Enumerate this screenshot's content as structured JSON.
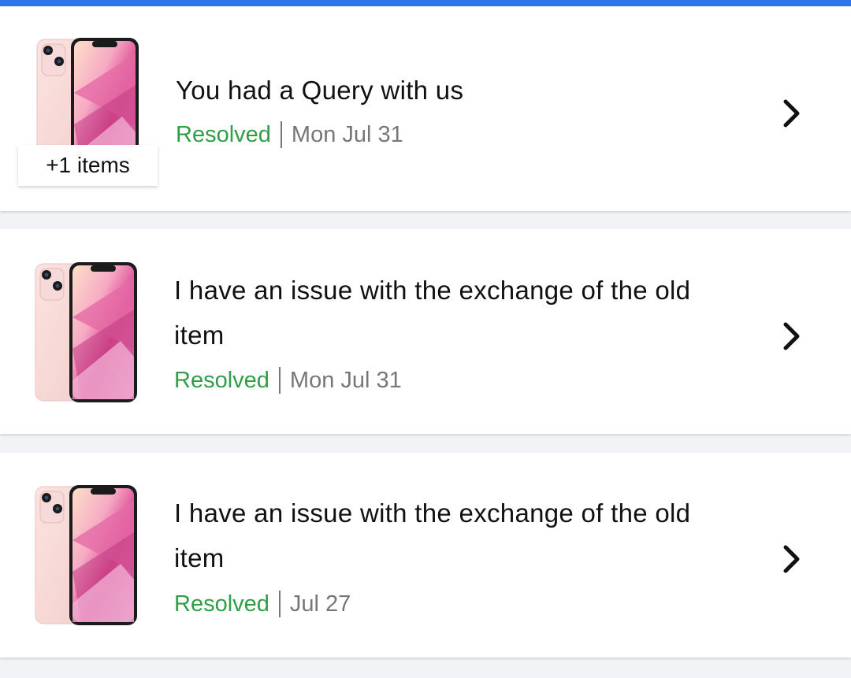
{
  "tickets": [
    {
      "title": "You had a Query with us",
      "status": "Resolved",
      "date": "Mon Jul 31",
      "extra_items": "+1 items",
      "product_icon": "pink-phone-image"
    },
    {
      "title": "I have an issue with the exchange of the old item",
      "status": "Resolved",
      "date": "Mon Jul 31",
      "product_icon": "pink-phone-image"
    },
    {
      "title": "I have an issue with the exchange of the old item",
      "status": "Resolved",
      "date": "Jul 27",
      "product_icon": "pink-phone-image"
    }
  ],
  "colors": {
    "accent_bar": "#2f74eb",
    "status_resolved": "#2e9e47",
    "date_text": "#777777"
  }
}
